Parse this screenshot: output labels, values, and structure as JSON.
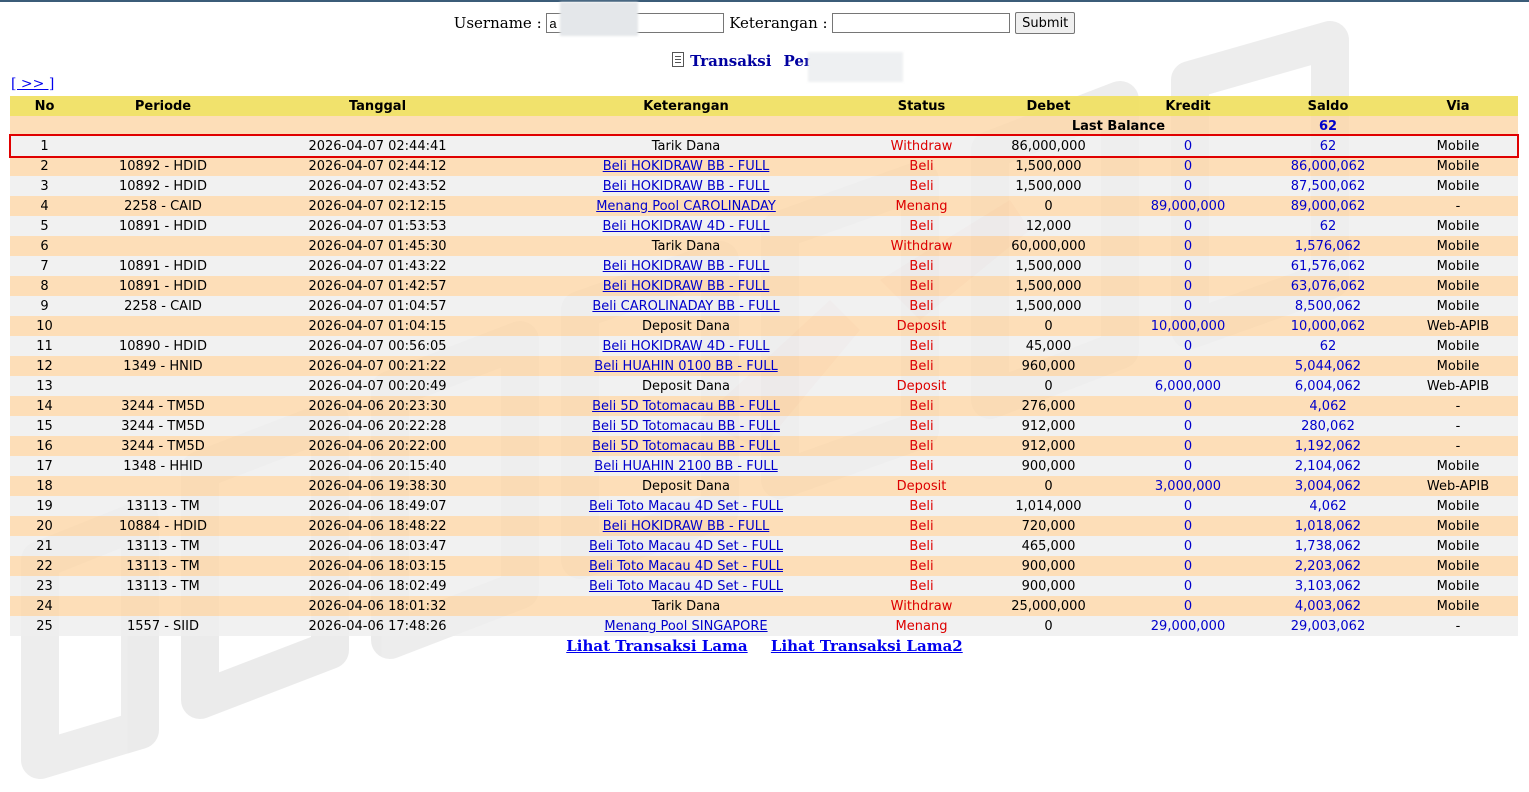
{
  "search": {
    "username_label": "Username :",
    "username_value": "a",
    "keterangan_label": "Keterangan :",
    "keterangan_value": "",
    "submit_label": "Submit"
  },
  "heading": {
    "title": "Transaksi",
    "player_label": "Pemain :"
  },
  "nav": {
    "next_label": "[ >> ]"
  },
  "table": {
    "headers": [
      "No",
      "Periode",
      "Tanggal",
      "Keterangan",
      "Status",
      "Debet",
      "Kredit",
      "Saldo",
      "Via"
    ],
    "last_balance_label": "Last Balance",
    "last_balance_value": "62",
    "rows": [
      {
        "no": "1",
        "periode": "",
        "tanggal": "2026-04-07 02:44:41",
        "keterangan": "Tarik Dana",
        "link": false,
        "status": "Withdraw",
        "debet": "86,000,000",
        "kredit": "0",
        "saldo": "62",
        "via": "Mobile"
      },
      {
        "no": "2",
        "periode": "10892 - HDID",
        "tanggal": "2026-04-07 02:44:12",
        "keterangan": "Beli HOKIDRAW BB - FULL",
        "link": true,
        "status": "Beli",
        "debet": "1,500,000",
        "kredit": "0",
        "saldo": "86,000,062",
        "via": "Mobile"
      },
      {
        "no": "3",
        "periode": "10892 - HDID",
        "tanggal": "2026-04-07 02:43:52",
        "keterangan": "Beli HOKIDRAW BB - FULL",
        "link": true,
        "status": "Beli",
        "debet": "1,500,000",
        "kredit": "0",
        "saldo": "87,500,062",
        "via": "Mobile"
      },
      {
        "no": "4",
        "periode": "2258 - CAID",
        "tanggal": "2026-04-07 02:12:15",
        "keterangan": "Menang Pool CAROLINADAY",
        "link": true,
        "status": "Menang",
        "debet": "0",
        "kredit": "89,000,000",
        "saldo": "89,000,062",
        "via": "-"
      },
      {
        "no": "5",
        "periode": "10891 - HDID",
        "tanggal": "2026-04-07 01:53:53",
        "keterangan": "Beli HOKIDRAW 4D - FULL",
        "link": true,
        "status": "Beli",
        "debet": "12,000",
        "kredit": "0",
        "saldo": "62",
        "via": "Mobile"
      },
      {
        "no": "6",
        "periode": "",
        "tanggal": "2026-04-07 01:45:30",
        "keterangan": "Tarik Dana",
        "link": false,
        "status": "Withdraw",
        "debet": "60,000,000",
        "kredit": "0",
        "saldo": "1,576,062",
        "via": "Mobile"
      },
      {
        "no": "7",
        "periode": "10891 - HDID",
        "tanggal": "2026-04-07 01:43:22",
        "keterangan": "Beli HOKIDRAW BB - FULL",
        "link": true,
        "status": "Beli",
        "debet": "1,500,000",
        "kredit": "0",
        "saldo": "61,576,062",
        "via": "Mobile"
      },
      {
        "no": "8",
        "periode": "10891 - HDID",
        "tanggal": "2026-04-07 01:42:57",
        "keterangan": "Beli HOKIDRAW BB - FULL",
        "link": true,
        "status": "Beli",
        "debet": "1,500,000",
        "kredit": "0",
        "saldo": "63,076,062",
        "via": "Mobile"
      },
      {
        "no": "9",
        "periode": "2258 - CAID",
        "tanggal": "2026-04-07 01:04:57",
        "keterangan": "Beli CAROLINADAY BB - FULL",
        "link": true,
        "status": "Beli",
        "debet": "1,500,000",
        "kredit": "0",
        "saldo": "8,500,062",
        "via": "Mobile"
      },
      {
        "no": "10",
        "periode": "",
        "tanggal": "2026-04-07 01:04:15",
        "keterangan": "Deposit Dana",
        "link": false,
        "status": "Deposit",
        "debet": "0",
        "kredit": "10,000,000",
        "saldo": "10,000,062",
        "via": "Web-APIB"
      },
      {
        "no": "11",
        "periode": "10890 - HDID",
        "tanggal": "2026-04-07 00:56:05",
        "keterangan": "Beli HOKIDRAW 4D - FULL",
        "link": true,
        "status": "Beli",
        "debet": "45,000",
        "kredit": "0",
        "saldo": "62",
        "via": "Mobile"
      },
      {
        "no": "12",
        "periode": "1349 - HNID",
        "tanggal": "2026-04-07 00:21:22",
        "keterangan": "Beli HUAHIN 0100 BB - FULL",
        "link": true,
        "status": "Beli",
        "debet": "960,000",
        "kredit": "0",
        "saldo": "5,044,062",
        "via": "Mobile"
      },
      {
        "no": "13",
        "periode": "",
        "tanggal": "2026-04-07 00:20:49",
        "keterangan": "Deposit Dana",
        "link": false,
        "status": "Deposit",
        "debet": "0",
        "kredit": "6,000,000",
        "saldo": "6,004,062",
        "via": "Web-APIB"
      },
      {
        "no": "14",
        "periode": "3244 - TM5D",
        "tanggal": "2026-04-06 20:23:30",
        "keterangan": "Beli 5D Totomacau BB - FULL",
        "link": true,
        "status": "Beli",
        "debet": "276,000",
        "kredit": "0",
        "saldo": "4,062",
        "via": "-"
      },
      {
        "no": "15",
        "periode": "3244 - TM5D",
        "tanggal": "2026-04-06 20:22:28",
        "keterangan": "Beli 5D Totomacau BB - FULL",
        "link": true,
        "status": "Beli",
        "debet": "912,000",
        "kredit": "0",
        "saldo": "280,062",
        "via": "-"
      },
      {
        "no": "16",
        "periode": "3244 - TM5D",
        "tanggal": "2026-04-06 20:22:00",
        "keterangan": "Beli 5D Totomacau BB - FULL",
        "link": true,
        "status": "Beli",
        "debet": "912,000",
        "kredit": "0",
        "saldo": "1,192,062",
        "via": "-"
      },
      {
        "no": "17",
        "periode": "1348 - HHID",
        "tanggal": "2026-04-06 20:15:40",
        "keterangan": "Beli HUAHIN 2100 BB - FULL",
        "link": true,
        "status": "Beli",
        "debet": "900,000",
        "kredit": "0",
        "saldo": "2,104,062",
        "via": "Mobile"
      },
      {
        "no": "18",
        "periode": "",
        "tanggal": "2026-04-06 19:38:30",
        "keterangan": "Deposit Dana",
        "link": false,
        "status": "Deposit",
        "debet": "0",
        "kredit": "3,000,000",
        "saldo": "3,004,062",
        "via": "Web-APIB"
      },
      {
        "no": "19",
        "periode": "13113 - TM",
        "tanggal": "2026-04-06 18:49:07",
        "keterangan": "Beli Toto Macau 4D Set - FULL",
        "link": true,
        "status": "Beli",
        "debet": "1,014,000",
        "kredit": "0",
        "saldo": "4,062",
        "via": "Mobile"
      },
      {
        "no": "20",
        "periode": "10884 - HDID",
        "tanggal": "2026-04-06 18:48:22",
        "keterangan": "Beli HOKIDRAW BB - FULL",
        "link": true,
        "status": "Beli",
        "debet": "720,000",
        "kredit": "0",
        "saldo": "1,018,062",
        "via": "Mobile"
      },
      {
        "no": "21",
        "periode": "13113 - TM",
        "tanggal": "2026-04-06 18:03:47",
        "keterangan": "Beli Toto Macau 4D Set - FULL",
        "link": true,
        "status": "Beli",
        "debet": "465,000",
        "kredit": "0",
        "saldo": "1,738,062",
        "via": "Mobile"
      },
      {
        "no": "22",
        "periode": "13113 - TM",
        "tanggal": "2026-04-06 18:03:15",
        "keterangan": "Beli Toto Macau 4D Set - FULL",
        "link": true,
        "status": "Beli",
        "debet": "900,000",
        "kredit": "0",
        "saldo": "2,203,062",
        "via": "Mobile"
      },
      {
        "no": "23",
        "periode": "13113 - TM",
        "tanggal": "2026-04-06 18:02:49",
        "keterangan": "Beli Toto Macau 4D Set - FULL",
        "link": true,
        "status": "Beli",
        "debet": "900,000",
        "kredit": "0",
        "saldo": "3,103,062",
        "via": "Mobile"
      },
      {
        "no": "24",
        "periode": "",
        "tanggal": "2026-04-06 18:01:32",
        "keterangan": "Tarik Dana",
        "link": false,
        "status": "Withdraw",
        "debet": "25,000,000",
        "kredit": "0",
        "saldo": "4,003,062",
        "via": "Mobile"
      },
      {
        "no": "25",
        "periode": "1557 - SIID",
        "tanggal": "2026-04-06 17:48:26",
        "keterangan": "Menang Pool SINGAPORE",
        "link": true,
        "status": "Menang",
        "debet": "0",
        "kredit": "29,000,000",
        "saldo": "29,003,062",
        "via": "-"
      }
    ]
  },
  "footer": {
    "old_tx_label": "Lihat Transaksi Lama",
    "old_tx2_label": "Lihat Transaksi Lama2"
  },
  "colors": {
    "header_bg": "#f0e060",
    "row_even_bg": "#fcd7a8",
    "row_odd_bg": "#eeeeee",
    "status_red": "#dd0000",
    "amount_blue": "#0000cc",
    "highlight_border": "#e00000"
  }
}
